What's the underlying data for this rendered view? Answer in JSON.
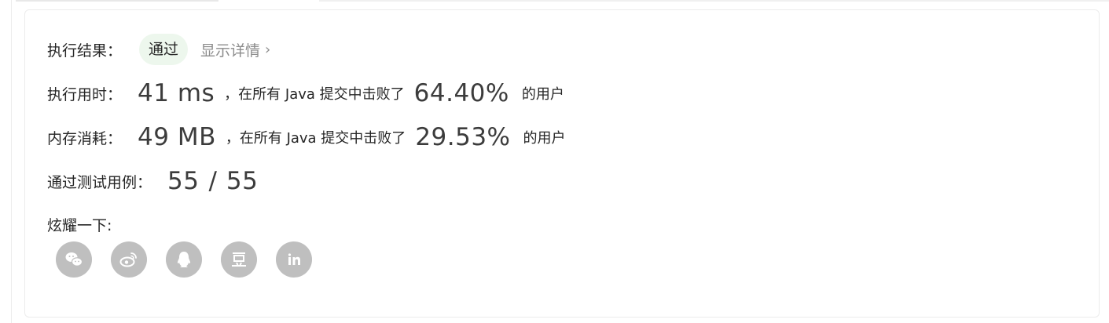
{
  "result": {
    "label": "执行结果：",
    "status": "通过",
    "details_link": "显示详情",
    "chevron": "›"
  },
  "runtime": {
    "label": "执行用时：",
    "value": "41 ms",
    "mid_text": "，在所有 Java 提交中击败了",
    "percent": "64.40%",
    "suffix": "的用户"
  },
  "memory": {
    "label": "内存消耗：",
    "value": "49 MB",
    "mid_text": "，在所有 Java 提交中击败了",
    "percent": "29.53%",
    "suffix": "的用户"
  },
  "tests": {
    "label": "通过测试用例：",
    "passed": "55",
    "separator": "/",
    "total": "55"
  },
  "share": {
    "label": "炫耀一下:",
    "icons": [
      "wechat-icon",
      "weibo-icon",
      "qq-icon",
      "douban-icon",
      "linkedin-icon"
    ]
  },
  "colors": {
    "badge_bg": "#edf7ed",
    "icon_bg": "#bfbfbf",
    "muted_text": "#8c8c8c"
  }
}
